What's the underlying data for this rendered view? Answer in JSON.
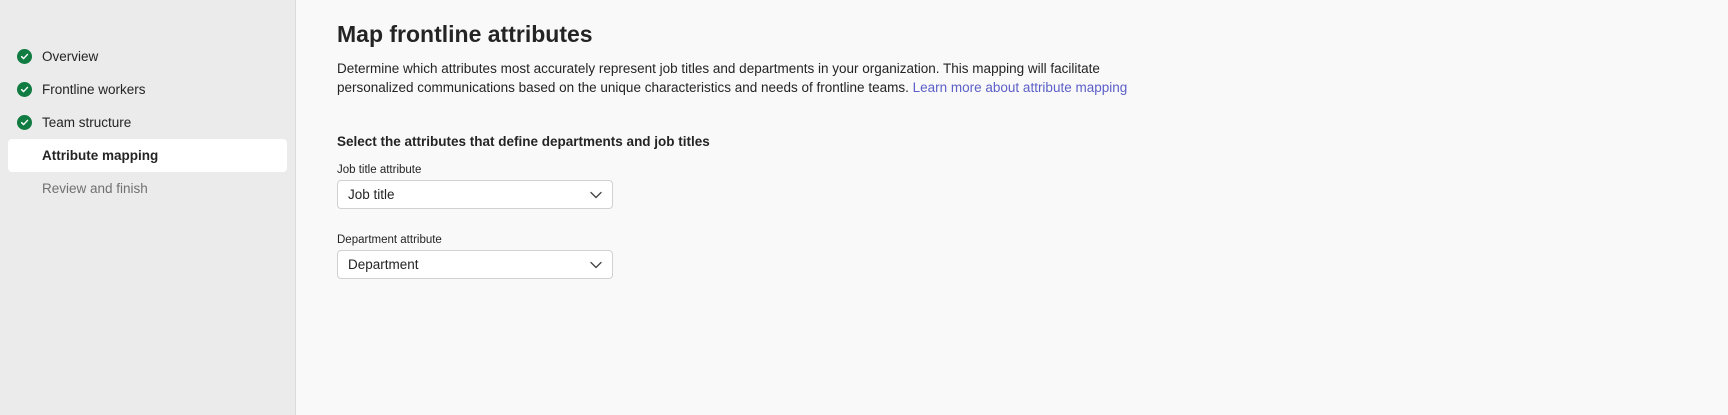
{
  "wizard": {
    "steps": [
      {
        "label": "Overview",
        "status": "complete"
      },
      {
        "label": "Frontline workers",
        "status": "complete"
      },
      {
        "label": "Team structure",
        "status": "complete"
      },
      {
        "label": "Attribute mapping",
        "status": "current"
      },
      {
        "label": "Review and finish",
        "status": "pending"
      }
    ]
  },
  "main": {
    "title": "Map frontline attributes",
    "description": "Determine which attributes most accurately represent job titles and departments in your organization. This mapping will facilitate personalized communications based on the unique characteristics and needs of frontline teams.",
    "learn_more_link": "Learn more about attribute mapping",
    "section_heading": "Select the attributes that define departments and job titles",
    "job_title": {
      "label": "Job title attribute",
      "value": "Job title"
    },
    "department": {
      "label": "Department attribute",
      "value": "Department"
    }
  },
  "colors": {
    "complete": "#107c41",
    "link": "#5b5fc7",
    "sidebar_bg": "#ebebeb",
    "page_bg": "#f9f9f9"
  },
  "icons": {
    "complete_step": "checkmark-circle-icon",
    "dropdown": "chevron-down-icon"
  }
}
